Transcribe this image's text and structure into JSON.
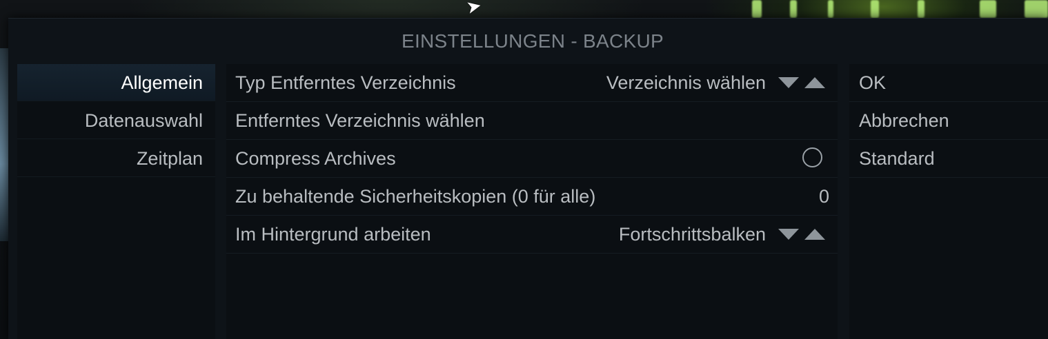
{
  "dialog": {
    "title": "EINSTELLUNGEN - BACKUP"
  },
  "categories": [
    {
      "label": "Allgemein",
      "selected": true
    },
    {
      "label": "Datenauswahl",
      "selected": false
    },
    {
      "label": "Zeitplan",
      "selected": false
    }
  ],
  "settings": [
    {
      "label": "Typ Entferntes Verzeichnis",
      "value": "Verzeichnis wählen",
      "control": "spinner"
    },
    {
      "label": "Entferntes Verzeichnis wählen",
      "value": "",
      "control": "button"
    },
    {
      "label": "Compress Archives",
      "value": "",
      "control": "radio",
      "checked": false
    },
    {
      "label": "Zu behaltende Sicherheitskopien (0 für alle)",
      "value": "0",
      "control": "number"
    },
    {
      "label": "Im Hintergrund arbeiten",
      "value": "Fortschrittsbalken",
      "control": "spinner"
    }
  ],
  "buttons": [
    {
      "label": "OK"
    },
    {
      "label": "Abbrechen"
    },
    {
      "label": "Standard"
    }
  ],
  "icons": {
    "spinner_down": "triangle-down-icon",
    "spinner_up": "triangle-up-icon",
    "radio": "radio-off-icon",
    "cursor": "mouse-pointer-icon"
  },
  "colors": {
    "background": "#0e1318",
    "panel": "#0b0f13",
    "selected": "#16232f",
    "text": "#b9bdc1",
    "title": "#7c838a"
  }
}
